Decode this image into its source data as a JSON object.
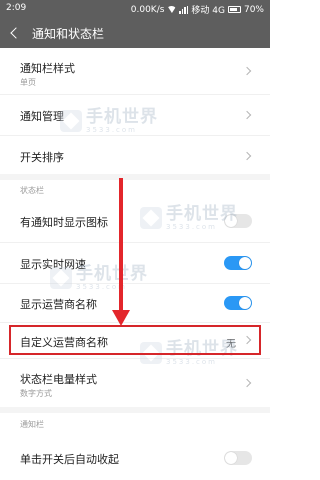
{
  "status_bar": {
    "time": "2:09",
    "speed": "0.00K/s",
    "carrier": "移动 4G",
    "battery": "70%"
  },
  "header": {
    "title": "通知和状态栏"
  },
  "rows": {
    "notif_style": {
      "label": "通知栏样式",
      "sub": "单页"
    },
    "notif_mgmt": {
      "label": "通知管理"
    },
    "switch_order": {
      "label": "开关排序"
    },
    "status_section": "状态栏",
    "show_icon": {
      "label": "有通知时显示图标",
      "state": "off"
    },
    "show_speed": {
      "label": "显示实时网速",
      "state": "on"
    },
    "show_carrier": {
      "label": "显示运营商名称",
      "state": "on"
    },
    "custom_carrier": {
      "label": "自定义运营商名称",
      "value": "无"
    },
    "battery_style": {
      "label": "状态栏电量样式",
      "sub": "数字方式"
    },
    "notif_section": "通知栏",
    "auto_collapse": {
      "label": "单击开关后自动收起",
      "state": "off"
    }
  },
  "watermark": {
    "text": "手机世界",
    "sub": "3533.com"
  },
  "colors": {
    "header_bg": "#5e5e5e",
    "toggle_on": "#2a98f5",
    "highlight": "#d6262a"
  }
}
